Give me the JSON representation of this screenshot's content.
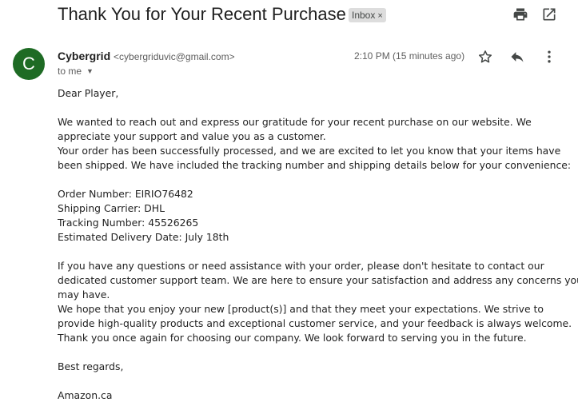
{
  "email": {
    "subject": "Thank You for Your Recent Purchase",
    "label": "Inbox",
    "label_close": "×",
    "sender_initial": "C",
    "sender_name": "Cybergrid",
    "sender_email": "<cybergriduvic@gmail.com>",
    "recipient": "to me",
    "timestamp": "2:10 PM (15 minutes ago)",
    "body_lines": [
      "Dear Player,",
      "",
      "We wanted to reach out and express our gratitude for your recent purchase on our website. We",
      "appreciate your support and value you as a customer.",
      "Your order has been successfully processed, and we are excited to let you know that your items have",
      "been shipped. We have included the tracking number and shipping details below for your convenience:",
      "",
      "Order Number: EIRIO76482",
      "Shipping Carrier: DHL",
      "Tracking Number: 45526265",
      "Estimated Delivery Date: July 18th",
      "",
      "If you have any questions or need assistance with your order, please don't hesitate to contact our",
      "dedicated customer support team. We are here to ensure your satisfaction and address any concerns you",
      "may have.",
      "We hope that you enjoy your new [product(s)] and that they meet your expectations. We strive to",
      "provide high-quality products and exceptional customer service, and your feedback is always welcome.",
      "Thank you once again for choosing our company. We look forward to serving you in the future.",
      "",
      "Best regards,",
      "",
      "Amazon.ca"
    ]
  },
  "icons": {
    "print": "print-icon",
    "open_new_window": "open-in-new-icon",
    "star": "star-icon",
    "reply": "reply-icon",
    "more": "more-vert-icon",
    "dropdown": "chevron-down-icon"
  },
  "colors": {
    "avatar_bg": "#1e6b24",
    "label_bg": "#dddddd",
    "text": "#222222",
    "muted": "#5e5e5e"
  }
}
